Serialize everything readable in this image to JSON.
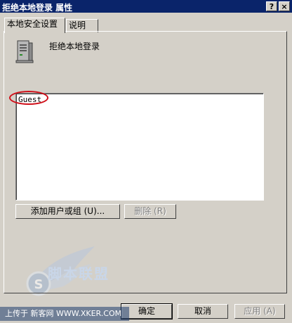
{
  "window": {
    "title": "拒绝本地登录 属性",
    "help_label": "?",
    "close_label": "×"
  },
  "tabs": [
    {
      "label": "本地安全设置",
      "active": true
    },
    {
      "label": "说明",
      "active": false
    }
  ],
  "policy": {
    "name": "拒绝本地登录",
    "icon": "server-computer-icon"
  },
  "members": [
    "Guest"
  ],
  "actions": {
    "add_label": "添加用户或组 (U)...",
    "remove_label": "删除 (R)"
  },
  "footer": {
    "ok_label": "确定",
    "cancel_label": "取消",
    "apply_label": "应用 (A)"
  },
  "watermark": {
    "brand": "脚本联盟",
    "url_text": "上传于 新客网 WWW.XKER.COM"
  },
  "colors": {
    "title_bar": "#0a246a",
    "face": "#d4d0c8",
    "annotation": "#d0101a"
  }
}
